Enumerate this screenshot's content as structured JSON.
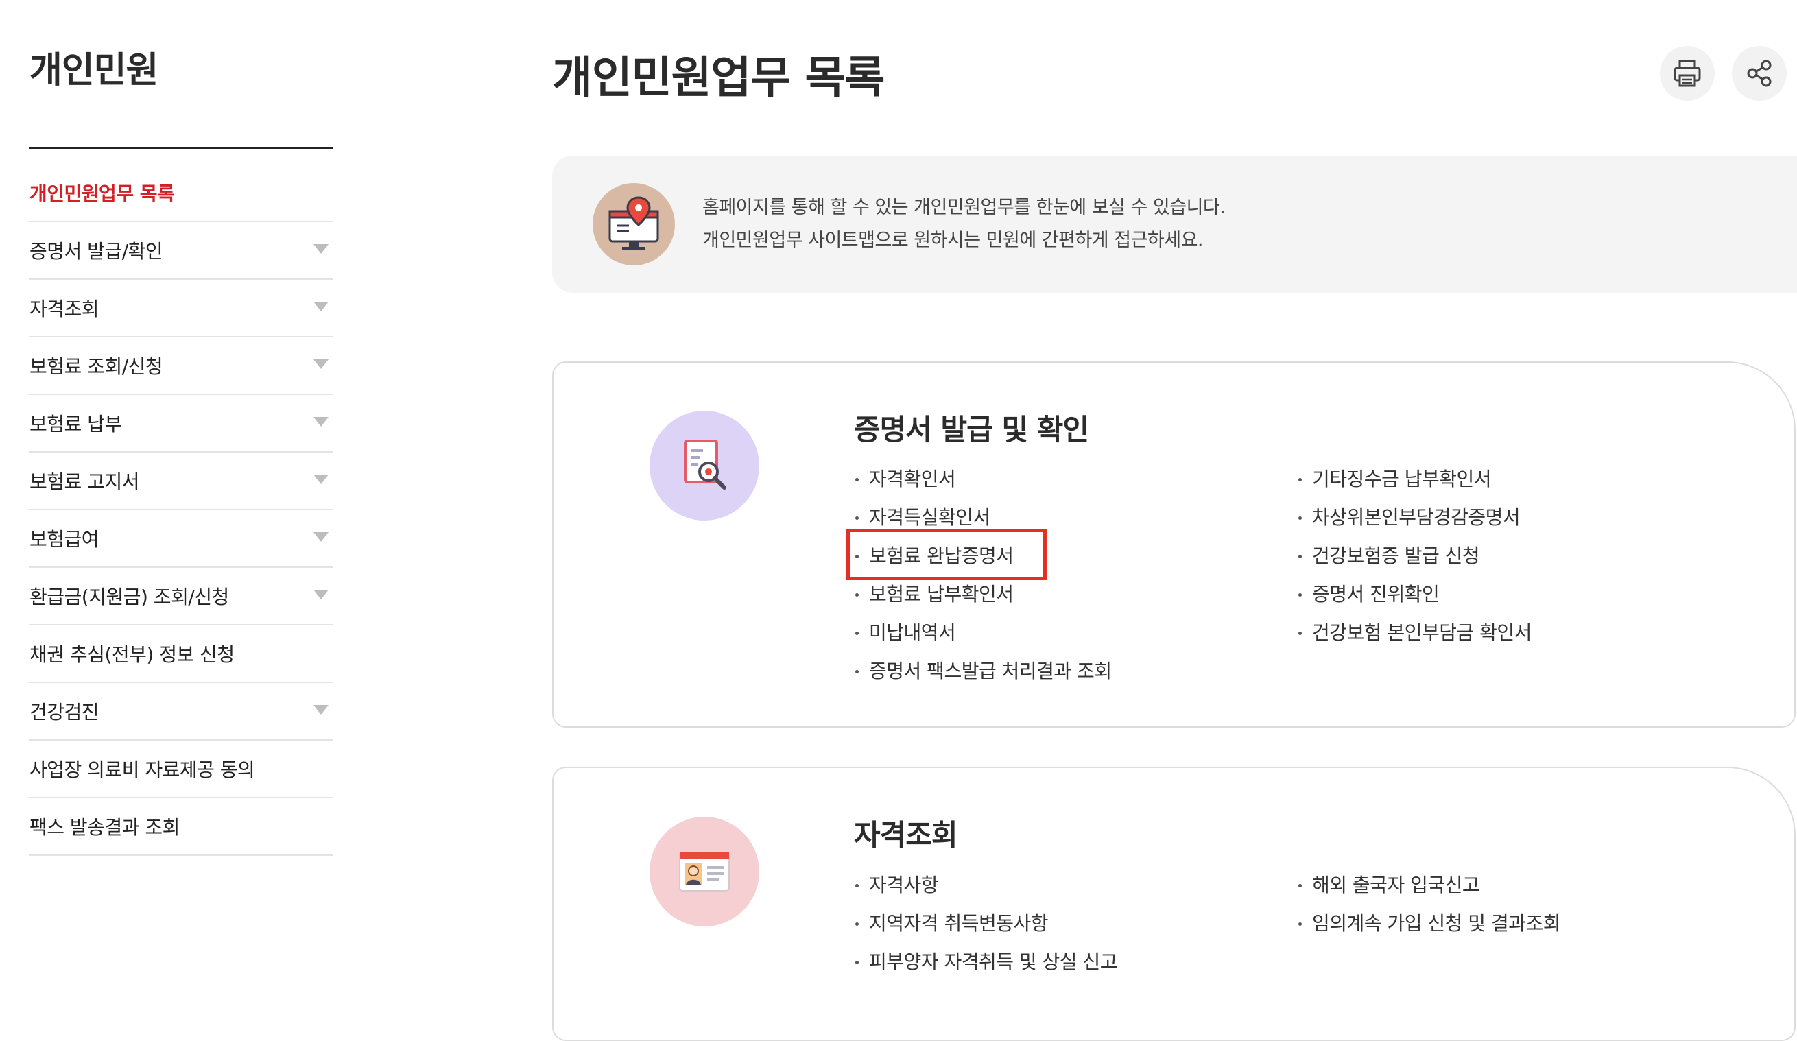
{
  "sidebar": {
    "title": "개인민원",
    "items": [
      {
        "label": "개인민원업무 목록",
        "active": true,
        "expandable": false
      },
      {
        "label": "증명서 발급/확인",
        "active": false,
        "expandable": true
      },
      {
        "label": "자격조회",
        "active": false,
        "expandable": true
      },
      {
        "label": "보험료 조회/신청",
        "active": false,
        "expandable": true
      },
      {
        "label": "보험료 납부",
        "active": false,
        "expandable": true
      },
      {
        "label": "보험료 고지서",
        "active": false,
        "expandable": true
      },
      {
        "label": "보험급여",
        "active": false,
        "expandable": true
      },
      {
        "label": "환급금(지원금) 조회/신청",
        "active": false,
        "expandable": true
      },
      {
        "label": "채권 추심(전부) 정보 신청",
        "active": false,
        "expandable": false
      },
      {
        "label": "건강검진",
        "active": false,
        "expandable": true
      },
      {
        "label": "사업장 의료비 자료제공 동의",
        "active": false,
        "expandable": false
      },
      {
        "label": "팩스 발송결과 조회",
        "active": false,
        "expandable": false
      }
    ]
  },
  "header": {
    "title": "개인민원업무 목록",
    "print_icon": "printer-icon",
    "share_icon": "share-icon"
  },
  "intro": {
    "icon": "monitor-location-icon",
    "line1": "홈페이지를 통해 할 수 있는 개인민원업무를 한눈에 보실 수 있습니다.",
    "line2": "개인민원업무 사이트맵으로 원하시는 민원에 간편하게 접근하세요."
  },
  "sections": [
    {
      "title": "증명서 발급 및 확인",
      "icon": "certificate-search-icon",
      "col1": [
        "자격확인서",
        "자격득실확인서",
        "보험료 완납증명서",
        "보험료 납부확인서",
        "미납내역서",
        "증명서 팩스발급 처리결과 조회"
      ],
      "col2": [
        "기타징수금 납부확인서",
        "차상위본인부담경감증명서",
        "건강보험증 발급 신청",
        "증명서 진위확인",
        "건강보험 본인부담금 확인서"
      ],
      "highlighted": "보험료 완납증명서"
    },
    {
      "title": "자격조회",
      "icon": "id-card-icon",
      "col1": [
        "자격사항",
        "지역자격 취득변동사항",
        "피부양자 자격취득 및 상실 신고"
      ],
      "col2": [
        "해외 출국자 입국신고",
        "임의계속 가입 신청 및 결과조회"
      ]
    }
  ],
  "colors": {
    "active": "#d31f26",
    "highlight": "#e62e22",
    "cert_icon_bg": "#dcd3f6",
    "qual_icon_bg": "#f6cfd3",
    "intro_icon_bg": "#d8b9a3"
  }
}
